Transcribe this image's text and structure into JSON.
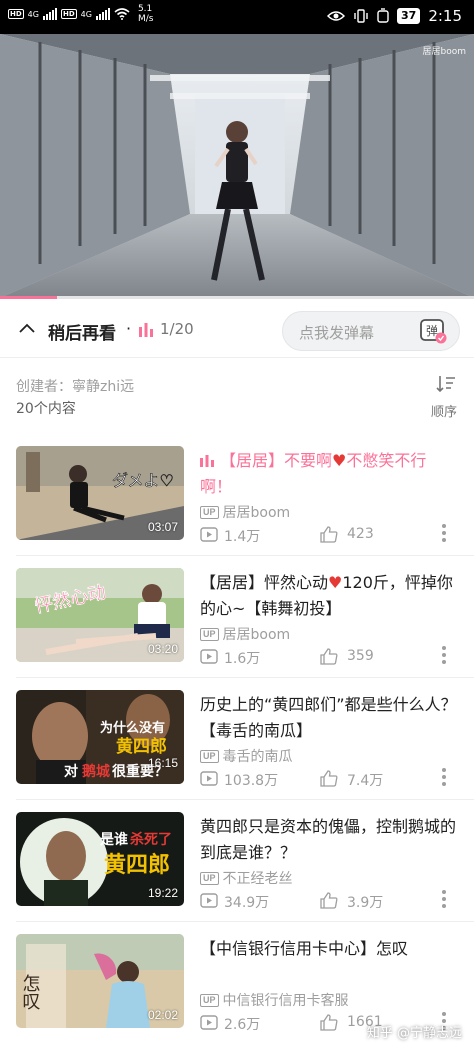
{
  "status_bar": {
    "net_left": "4G",
    "net_right": "4G",
    "speed_value": "5.1",
    "speed_unit": "M/s",
    "battery": "37",
    "time": "2:15"
  },
  "video": {
    "watermark": "居居boom",
    "progress_fraction": 0.12
  },
  "header": {
    "title": "稍后再看",
    "separator": "·",
    "count": "1/20",
    "danmaku_placeholder": "点我发弹幕",
    "danmaku_icon_label": "弹"
  },
  "list_info": {
    "creator": "创建者：寧静zhi远",
    "item_count": "20个内容",
    "sort_label": "顺序"
  },
  "colors": {
    "accent": "#fb7299",
    "heart": "#e53935"
  },
  "items": [
    {
      "title_a": "【居居】不要啊",
      "title_b": "不憋笑不行啊！",
      "duration": "03:07",
      "uploader": "居居boom",
      "views": "1.4万",
      "likes": "423",
      "thumb_text": "ダメよ♡"
    },
    {
      "title_a": "【居居】怦然心动",
      "title_b": "120斤，怦掉你的心~【韩舞初投】",
      "duration": "03:20",
      "uploader": "居居boom",
      "views": "1.6万",
      "likes": "359",
      "thumb_text": "怦然心动"
    },
    {
      "title": "历史上的“黄四郎们”都是些什么人？【毒舌的南瓜】",
      "duration": "16:15",
      "uploader": "毒舌的南瓜",
      "views": "103.8万",
      "likes": "7.4万",
      "thumb_line1": "为什么没有",
      "thumb_line2": "黄四郎",
      "thumb_line3_a": "对",
      "thumb_line3_b": "鹅城",
      "thumb_line3_c": "很重要？"
    },
    {
      "title": "黄四郎只是资本的傀儡，控制鹅城的到底是谁？？",
      "duration": "19:22",
      "uploader": "不正经老丝",
      "views": "34.9万",
      "likes": "3.9万",
      "thumb_line1_a": "是谁",
      "thumb_line1_b": "杀死了",
      "thumb_line2": "黄四郎"
    },
    {
      "title": "【中信银行信用卡中心】怎叹",
      "duration": "02:02",
      "uploader": "中信银行信用卡客服",
      "views": "2.6万",
      "likes": "1661",
      "thumb_text": "怎叹"
    }
  ],
  "footer_watermark": "知乎 @宁静志远"
}
